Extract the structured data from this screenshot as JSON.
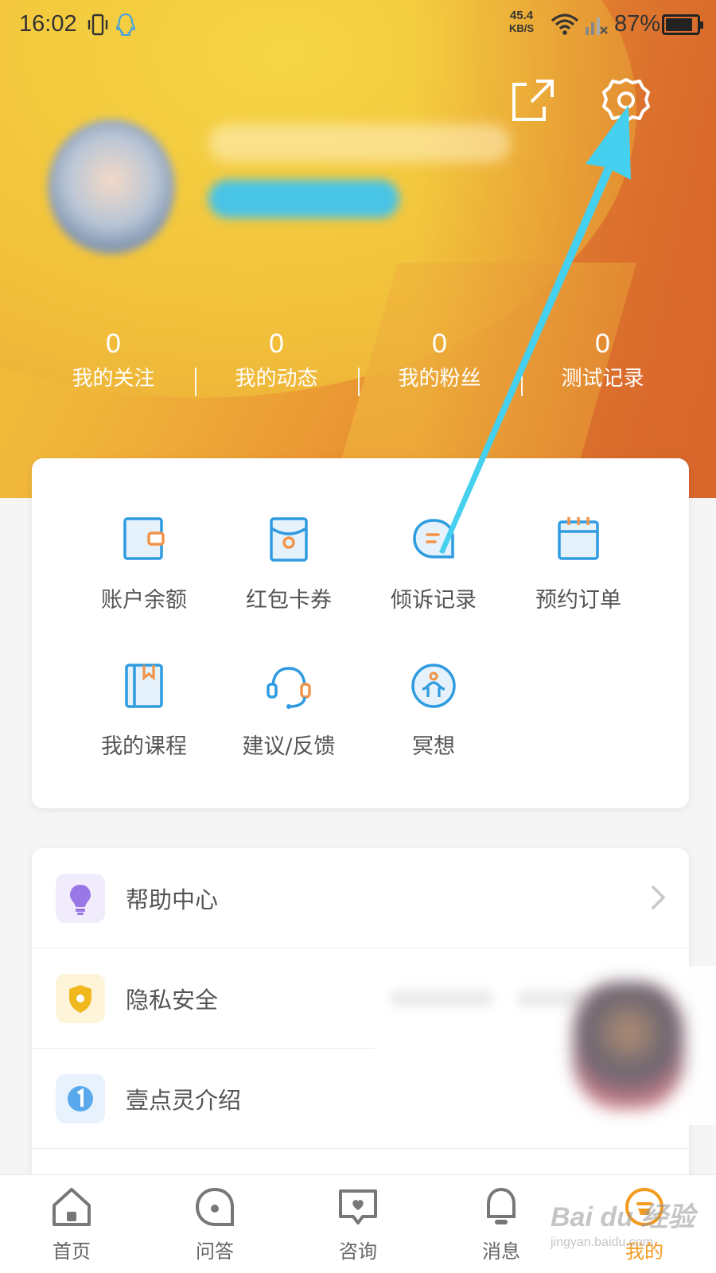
{
  "status_bar": {
    "time": "16:02",
    "net_speed_value": "45.4",
    "net_speed_unit": "KB/S",
    "battery_percent": "87%"
  },
  "profile": {
    "name": "",
    "badge": ""
  },
  "stats": [
    {
      "value": "0",
      "label": "我的关注"
    },
    {
      "value": "0",
      "label": "我的动态"
    },
    {
      "value": "0",
      "label": "我的粉丝"
    },
    {
      "value": "0",
      "label": "测试记录"
    }
  ],
  "grid": [
    {
      "label": "账户余额",
      "icon": "wallet-icon"
    },
    {
      "label": "红包卡券",
      "icon": "red-packet-icon"
    },
    {
      "label": "倾诉记录",
      "icon": "chat-bubble-icon"
    },
    {
      "label": "预约订单",
      "icon": "calendar-icon"
    },
    {
      "label": "我的课程",
      "icon": "book-icon"
    },
    {
      "label": "建议/反馈",
      "icon": "headset-icon"
    },
    {
      "label": "冥想",
      "icon": "meditation-icon"
    }
  ],
  "menu": [
    {
      "label": "帮助中心",
      "icon": "lightbulb-icon"
    },
    {
      "label": "隐私安全",
      "icon": "shield-icon"
    },
    {
      "label": "壹点灵介绍",
      "icon": "info-one-icon"
    }
  ],
  "tabs": [
    {
      "label": "首页",
      "icon": "home-icon"
    },
    {
      "label": "问答",
      "icon": "qa-icon"
    },
    {
      "label": "咨询",
      "icon": "consult-icon"
    },
    {
      "label": "消息",
      "icon": "bell-icon"
    },
    {
      "label": "我的",
      "icon": "profile-icon",
      "active": true
    }
  ],
  "watermark": {
    "line1": "Bai du 经验",
    "line2": "jingyan.baidu.com"
  },
  "colors": {
    "accent": "#f39b1f",
    "icon_blue": "#2f9be0",
    "icon_orange": "#f0944a",
    "annotation_arrow": "#45d0ef"
  }
}
